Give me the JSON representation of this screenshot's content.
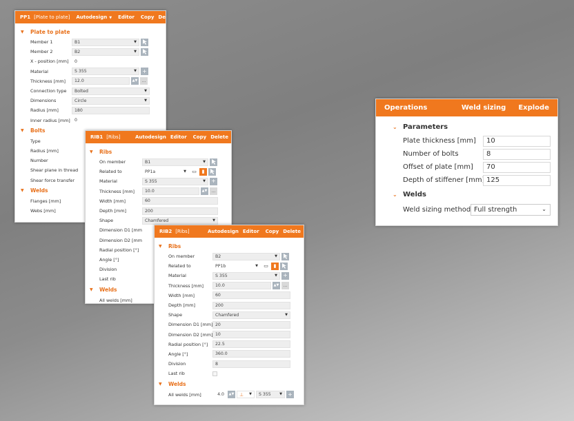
{
  "pp1": {
    "code": "PP1",
    "name": "[Plate to plate]",
    "actions": {
      "autodesign": "Autodesign",
      "editor": "Editor",
      "copy": "Copy",
      "delete": "Delete"
    },
    "sec_plate": "Plate to plate",
    "sec_bolts": "Bolts",
    "sec_welds": "Welds",
    "rows": {
      "member1": {
        "label": "Member 1",
        "value": "B1"
      },
      "member2": {
        "label": "Member 2",
        "value": "B2"
      },
      "xpos": {
        "label": "X - position [mm]",
        "value": "0"
      },
      "material": {
        "label": "Material",
        "value": "S 355"
      },
      "thickness": {
        "label": "Thickness [mm]",
        "value": "12.0"
      },
      "conntype": {
        "label": "Connection type",
        "value": "Bolted"
      },
      "dimensions": {
        "label": "Dimensions",
        "value": "Circle"
      },
      "radius": {
        "label": "Radius [mm]",
        "value": "180"
      },
      "innerradius": {
        "label": "Inner radius [mm]",
        "value": "0"
      }
    },
    "bolts_rows": [
      "Type",
      "Radius [mm]",
      "Number",
      "Shear plane in thread",
      "Shear force transfer"
    ],
    "welds_rows": [
      "Flanges [mm]",
      "Webs [mm]"
    ]
  },
  "rib1": {
    "code": "RIB1",
    "name": "[Ribs]",
    "actions": {
      "autodesign": "Autodesign",
      "editor": "Editor",
      "copy": "Copy",
      "delete": "Delete"
    },
    "sec_ribs": "Ribs",
    "sec_welds": "Welds",
    "rows": {
      "onmember": {
        "label": "On member",
        "value": "B1"
      },
      "relatedto": {
        "label": "Related to",
        "value": "PP1a"
      },
      "material": {
        "label": "Material",
        "value": "S 355"
      },
      "thickness": {
        "label": "Thickness [mm]",
        "value": "10.0"
      },
      "width": {
        "label": "Width [mm]",
        "value": "60"
      },
      "depth": {
        "label": "Depth [mm]",
        "value": "200"
      },
      "shape": {
        "label": "Shape",
        "value": "Chamfered"
      }
    },
    "labels_only": [
      "Dimension D1 [mm]",
      "Dimension D2 [mm]",
      "Radial position [°]",
      "Angle [°]",
      "Division",
      "Last rib"
    ],
    "allwelds": "All welds [mm]"
  },
  "rib2": {
    "code": "RIB2",
    "name": "[Ribs]",
    "actions": {
      "autodesign": "Autodesign",
      "editor": "Editor",
      "copy": "Copy",
      "delete": "Delete"
    },
    "sec_ribs": "Ribs",
    "sec_welds": "Welds",
    "rows": {
      "onmember": {
        "label": "On member",
        "value": "B2"
      },
      "relatedto": {
        "label": "Related to",
        "value": "PP1b"
      },
      "material": {
        "label": "Material",
        "value": "S 355"
      },
      "thickness": {
        "label": "Thickness [mm]",
        "value": "10.0"
      },
      "width": {
        "label": "Width [mm]",
        "value": "60"
      },
      "depth": {
        "label": "Depth [mm]",
        "value": "200"
      },
      "shape": {
        "label": "Shape",
        "value": "Chamfered"
      },
      "d1": {
        "label": "Dimension D1 [mm]",
        "value": "20"
      },
      "d2": {
        "label": "Dimension D2 [mm]",
        "value": "10"
      },
      "radial": {
        "label": "Radial position [°]",
        "value": "22.5"
      },
      "angle": {
        "label": "Angle [°]",
        "value": "360.0"
      },
      "division": {
        "label": "Division",
        "value": "8"
      },
      "lastrib": {
        "label": "Last rib"
      }
    },
    "allwelds": {
      "label": "All welds [mm]",
      "value": "4.0",
      "material": "S 355"
    }
  },
  "ops": {
    "title": "Operations",
    "weld_sizing": "Weld sizing",
    "explode": "Explode",
    "sec_params": "Parameters",
    "sec_welds": "Welds",
    "rows": {
      "plate_thickness": {
        "label": "Plate thickness [mm]",
        "value": "10"
      },
      "num_bolts": {
        "label": "Number of bolts",
        "value": "8"
      },
      "offset": {
        "label": "Offset of plate [mm]",
        "value": "70"
      },
      "depth_stiff": {
        "label": "Depth of stiffener [mm]",
        "value": "125"
      },
      "weld_method": {
        "label": "Weld sizing method",
        "value": "Full strength"
      }
    }
  },
  "colors": {
    "accent": "#f0781e",
    "button": "#aab4bd",
    "field": "#eeeeee"
  }
}
